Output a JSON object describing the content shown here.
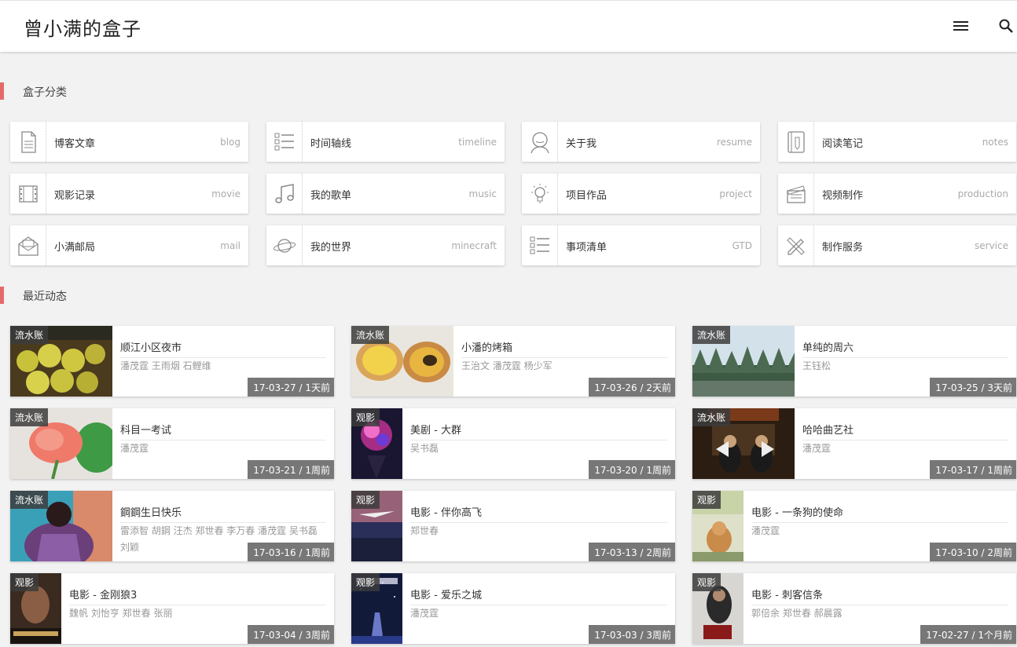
{
  "site": {
    "title": "曾小满的盒子"
  },
  "sections": {
    "categories_title": "盒子分类",
    "recent_title": "最近动态"
  },
  "categories": [
    {
      "cn": "博客文章",
      "en": "blog",
      "icon": "document-icon"
    },
    {
      "cn": "时间轴线",
      "en": "timeline",
      "icon": "checklist-icon"
    },
    {
      "cn": "关于我",
      "en": "resume",
      "icon": "person-icon"
    },
    {
      "cn": "阅读笔记",
      "en": "notes",
      "icon": "notebook-icon"
    },
    {
      "cn": "观影记录",
      "en": "movie",
      "icon": "film-icon"
    },
    {
      "cn": "我的歌单",
      "en": "music",
      "icon": "music-note-icon"
    },
    {
      "cn": "项目作品",
      "en": "project",
      "icon": "lightbulb-icon"
    },
    {
      "cn": "视频制作",
      "en": "production",
      "icon": "clapperboard-icon"
    },
    {
      "cn": "小满邮局",
      "en": "mail",
      "icon": "mailbox-icon"
    },
    {
      "cn": "我的世界",
      "en": "minecraft",
      "icon": "planet-icon"
    },
    {
      "cn": "事项清单",
      "en": "GTD",
      "icon": "todo-list-icon"
    },
    {
      "cn": "制作服务",
      "en": "service",
      "icon": "pencil-ruler-icon"
    }
  ],
  "feed": [
    {
      "tag": "流水账",
      "title": "顺江小区夜市",
      "people": "潘茂霆 王雨烟 石鲤维",
      "date": "17-03-27 / 1天前"
    },
    {
      "tag": "流水账",
      "title": "小潘的烤箱",
      "people": "王治文 潘茂霆 杨少军",
      "date": "17-03-26 / 2天前"
    },
    {
      "tag": "流水账",
      "title": "单纯的周六",
      "people": "王钰松",
      "date": "17-03-25 / 3天前"
    },
    {
      "tag": "流水账",
      "title": "科目一考试",
      "people": "潘茂霆",
      "date": "17-03-21 / 1周前"
    },
    {
      "tag": "观影",
      "title": "美剧 - 大群",
      "people": "吴书磊",
      "date": "17-03-20 / 1周前"
    },
    {
      "tag": "流水账",
      "title": "哈哈曲艺社",
      "people": "潘茂霆",
      "date": "17-03-17 / 1周前"
    },
    {
      "tag": "流水账",
      "title": "鋼鋼生日快乐",
      "people": "雷添智 胡鋼 汪杰 郑世春 李万春 潘茂霆 吴书磊 刘颖",
      "date": "17-03-16 / 1周前"
    },
    {
      "tag": "观影",
      "title": "电影 - 伴你高飞",
      "people": "郑世春",
      "date": "17-03-13 / 2周前"
    },
    {
      "tag": "观影",
      "title": "电影 - 一条狗的使命",
      "people": "潘茂霆",
      "date": "17-03-10 / 2周前"
    },
    {
      "tag": "观影",
      "title": "电影 - 金刚狼3",
      "people": "魏帆 刘怡亨 郑世春 张丽",
      "date": "17-03-04 / 3周前"
    },
    {
      "tag": "观影",
      "title": "电影 - 爱乐之城",
      "people": "潘茂霆",
      "date": "17-03-03 / 3周前"
    },
    {
      "tag": "观影",
      "title": "电影 - 刺客信条",
      "people": "郭倍余 郑世春 郝晨露",
      "date": "17-02-27 / 1个月前"
    }
  ]
}
